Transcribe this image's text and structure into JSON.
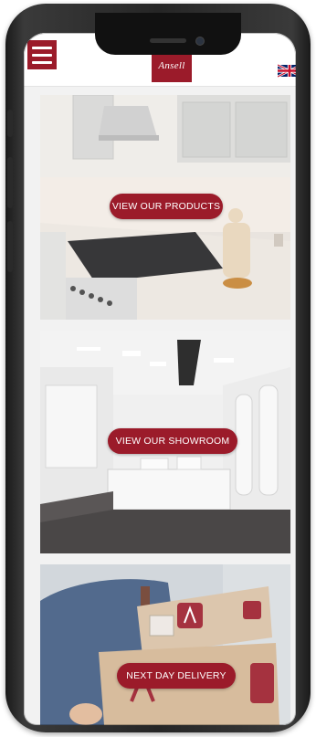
{
  "header": {
    "menu_icon": "hamburger-menu-icon",
    "logo_text": "Ansell",
    "language_flag": "uk-flag-icon"
  },
  "panels": [
    {
      "button_label": "VIEW OUR PRODUCTS",
      "scene": "kitchen"
    },
    {
      "button_label": "VIEW OUR SHOWROOM",
      "scene": "showroom"
    },
    {
      "button_label": "NEXT DAY DELIVERY",
      "scene": "delivery"
    }
  ],
  "colors": {
    "brand": "#9b1b2a",
    "header_bg": "#ffffff",
    "page_bg": "#f2f2f2"
  }
}
